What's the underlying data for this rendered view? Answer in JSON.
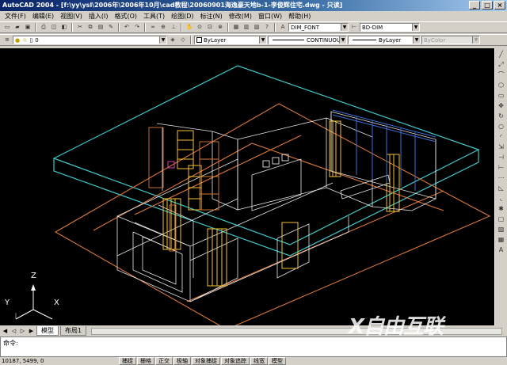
{
  "window": {
    "title": "AutoCAD 2004 - [f:\\yy\\ysl\\2006年\\2006年10月\\cad教程\\20060901海逸豪天地b-1-李俊辉住宅.dwg - 只读]",
    "buttons": [
      "_",
      "□",
      "×"
    ]
  },
  "menu": [
    "文件(F)",
    "编辑(E)",
    "视图(V)",
    "插入(I)",
    "格式(O)",
    "工具(T)",
    "绘图(D)",
    "标注(N)",
    "修改(M)",
    "窗口(W)",
    "帮助(H)"
  ],
  "toolbar": {
    "text_style": "DIM_FONT",
    "dim_style": "BD-DIM"
  },
  "properties_bar": {
    "layer_value": "0",
    "color": "ByLayer",
    "linetype": "CONTINUOUS",
    "lineweight": "ByLayer",
    "plotstyle": "ByColor"
  },
  "ucs": {
    "x": "X",
    "y": "Y",
    "z": "Z"
  },
  "tabs": [
    {
      "label": "模型",
      "active": true
    },
    {
      "label": "布局1",
      "active": false
    }
  ],
  "command": {
    "prompt": "命令:"
  },
  "status": {
    "coords": "10187, 5499, 0",
    "toggles": [
      "捕捉",
      "栅格",
      "正交",
      "极轴",
      "对象捕捉",
      "对象追踪",
      "线宽",
      "模型"
    ]
  },
  "watermark": "X自由互联",
  "colors": {
    "canvas": "#000000",
    "cyan": "#3fc8c8",
    "orange": "#d9783a",
    "white_lines": "#e8e8e8",
    "yellow": "#f2c233",
    "magenta": "#d43cb0"
  }
}
